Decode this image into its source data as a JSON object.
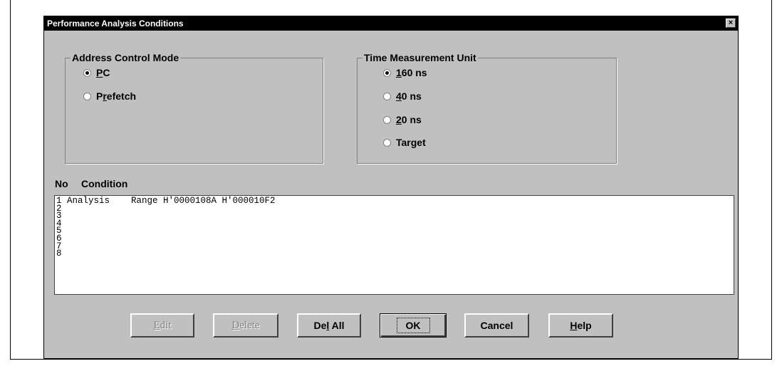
{
  "window": {
    "title": "Performance Analysis Conditions",
    "close": "×"
  },
  "address_mode": {
    "legend": "Address Control Mode",
    "options": [
      {
        "accel": "P",
        "rest": "C",
        "checked": true
      },
      {
        "pre": "P",
        "accel": "r",
        "rest": "efetch",
        "checked": false
      }
    ]
  },
  "time_unit": {
    "legend": "Time Measurement Unit",
    "options": [
      {
        "accel": "1",
        "rest": "60 ns",
        "checked": true
      },
      {
        "accel": "4",
        "rest": "0 ns",
        "checked": false
      },
      {
        "accel": "2",
        "rest": "0 ns",
        "checked": false
      },
      {
        "label": "Target",
        "checked": false
      }
    ]
  },
  "list": {
    "col_no": "No",
    "col_condition": "Condition",
    "rows": [
      "1 Analysis    Range H'0000108A H'000010F2",
      "2",
      "3",
      "4",
      "5",
      "6",
      "7",
      "8"
    ]
  },
  "buttons": {
    "edit": {
      "accel": "E",
      "rest": "dit"
    },
    "delete": {
      "accel": "D",
      "rest": "elete"
    },
    "del_all": {
      "pre": "De",
      "accel": "l",
      "rest": " All"
    },
    "ok": "OK",
    "cancel": "Cancel",
    "help": {
      "accel": "H",
      "rest": "elp"
    }
  }
}
